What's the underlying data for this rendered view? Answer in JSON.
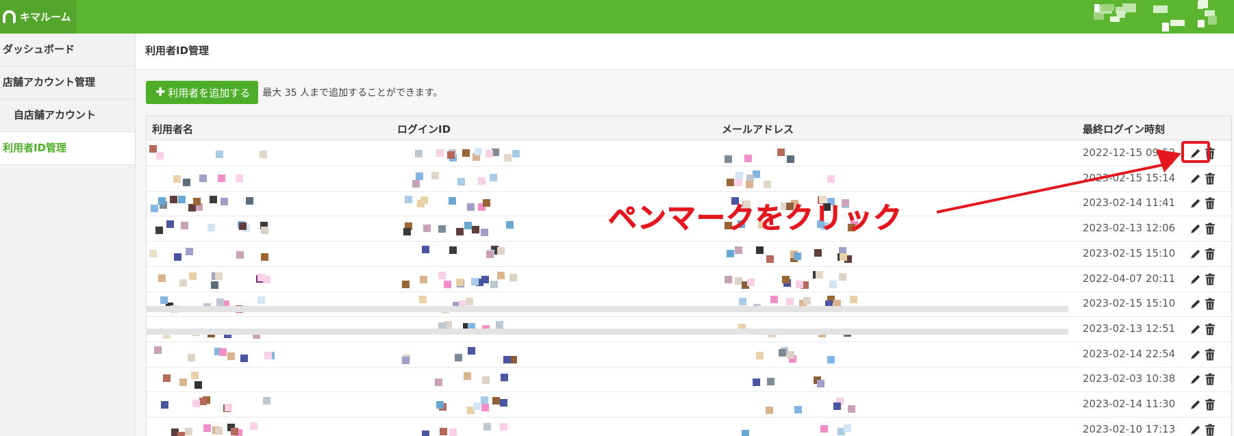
{
  "app": {
    "title": "キマルーム"
  },
  "sidebar": {
    "items": [
      {
        "label": "ダッシュボード"
      },
      {
        "label": "店舗アカウント管理"
      },
      {
        "label": "自店舗アカウント"
      },
      {
        "label": "利用者ID管理"
      }
    ]
  },
  "page": {
    "title": "利用者ID管理",
    "add_button_label": "利用者を追加する",
    "add_note": "最大 35 人まで追加することができます。"
  },
  "table": {
    "columns": [
      "利用者名",
      "ログインID",
      "メールアドレス",
      "最終ログイン時刻"
    ],
    "rows": [
      {
        "last_login": "2022-12-15 09:52"
      },
      {
        "last_login": "2023-02-15 15:14"
      },
      {
        "last_login": "2023-02-14 11:41"
      },
      {
        "last_login": "2023-02-13 12:06"
      },
      {
        "last_login": "2023-02-15 15:10"
      },
      {
        "last_login": "2022-04-07 20:11"
      },
      {
        "last_login": "2023-02-15 15:10"
      },
      {
        "last_login": "2023-02-13 12:51"
      },
      {
        "last_login": "2023-02-14 22:54"
      },
      {
        "last_login": "2023-02-03 10:38"
      },
      {
        "last_login": "2023-02-14 11:30"
      },
      {
        "last_login": "2023-02-10 17:13"
      }
    ]
  },
  "annotation": {
    "text": "ペンマークをクリック"
  },
  "colors": {
    "brand": "#5cb531",
    "annotation": "#e4171e"
  },
  "icons": {
    "edit": "pencil-icon",
    "delete": "trash-icon",
    "add": "plus-icon"
  }
}
